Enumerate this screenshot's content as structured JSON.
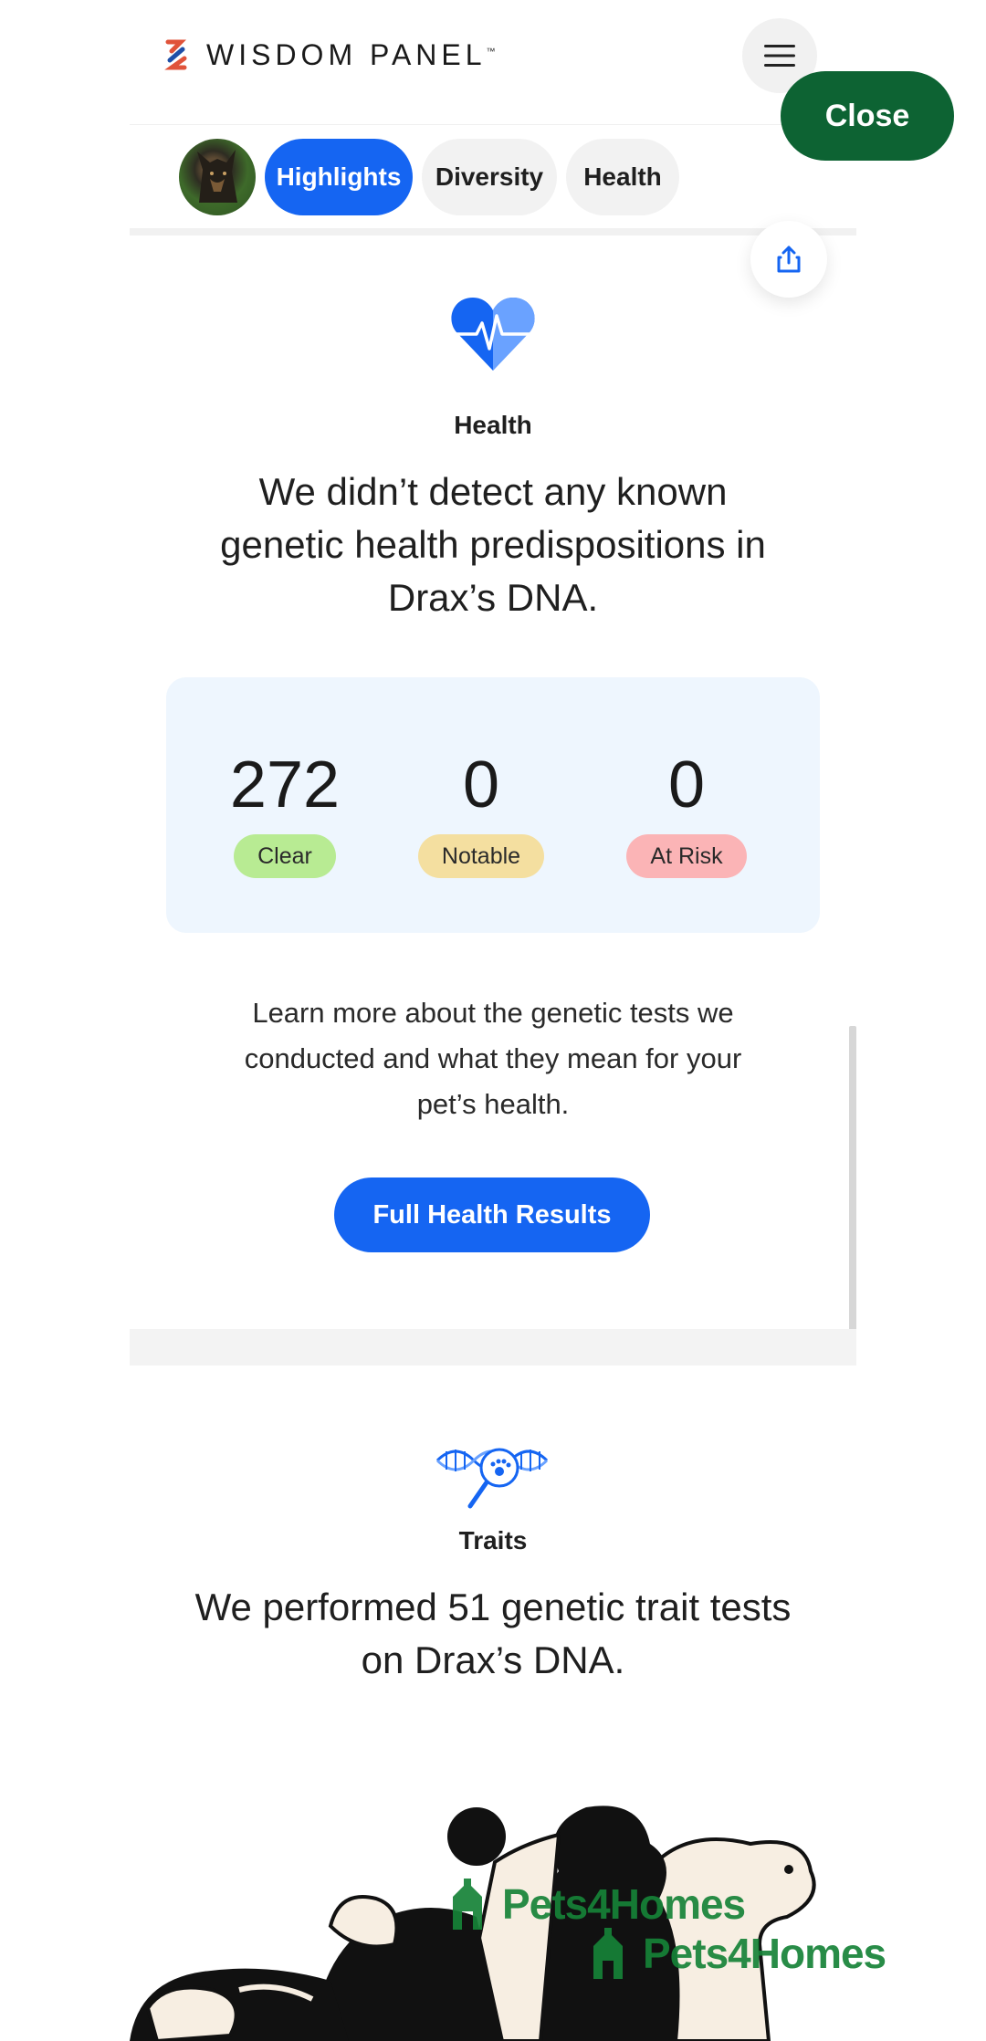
{
  "header": {
    "brand": "WISDOM PANEL",
    "brand_tm": "™",
    "menu_icon": "hamburger-menu-icon",
    "close_label": "Close"
  },
  "tabs": [
    {
      "label": "Highlights",
      "active": true
    },
    {
      "label": "Diversity",
      "active": false
    },
    {
      "label": "Health",
      "active": false
    }
  ],
  "health": {
    "icon": "heart-pulse-icon",
    "section_label": "Health",
    "headline_line1": "We didn’t detect any known",
    "headline_line2": "genetic health predispositions in",
    "headline_line3": "Drax’s DNA.",
    "stats": [
      {
        "value": "272",
        "label": "Clear",
        "color": "#b8eb93"
      },
      {
        "value": "0",
        "label": "Notable",
        "color": "#f4dfa0"
      },
      {
        "value": "0",
        "label": "At Risk",
        "color": "#fbb4b6"
      }
    ],
    "body_line1": "Learn more about the genetic tests we",
    "body_line2": "conducted and what they mean for your",
    "body_line3": "pet’s health.",
    "button_label": "Full Health Results"
  },
  "traits": {
    "icon": "dna-paw-magnifier-icon",
    "section_label": "Traits",
    "headline_line1": "We performed 51 genetic trait tests",
    "headline_line2": "on Drax’s DNA."
  },
  "watermark": {
    "text": "Pets4Homes"
  },
  "colors": {
    "primary": "#1565f2",
    "close_button": "#0d6333",
    "card_bg": "#eef6fe"
  }
}
